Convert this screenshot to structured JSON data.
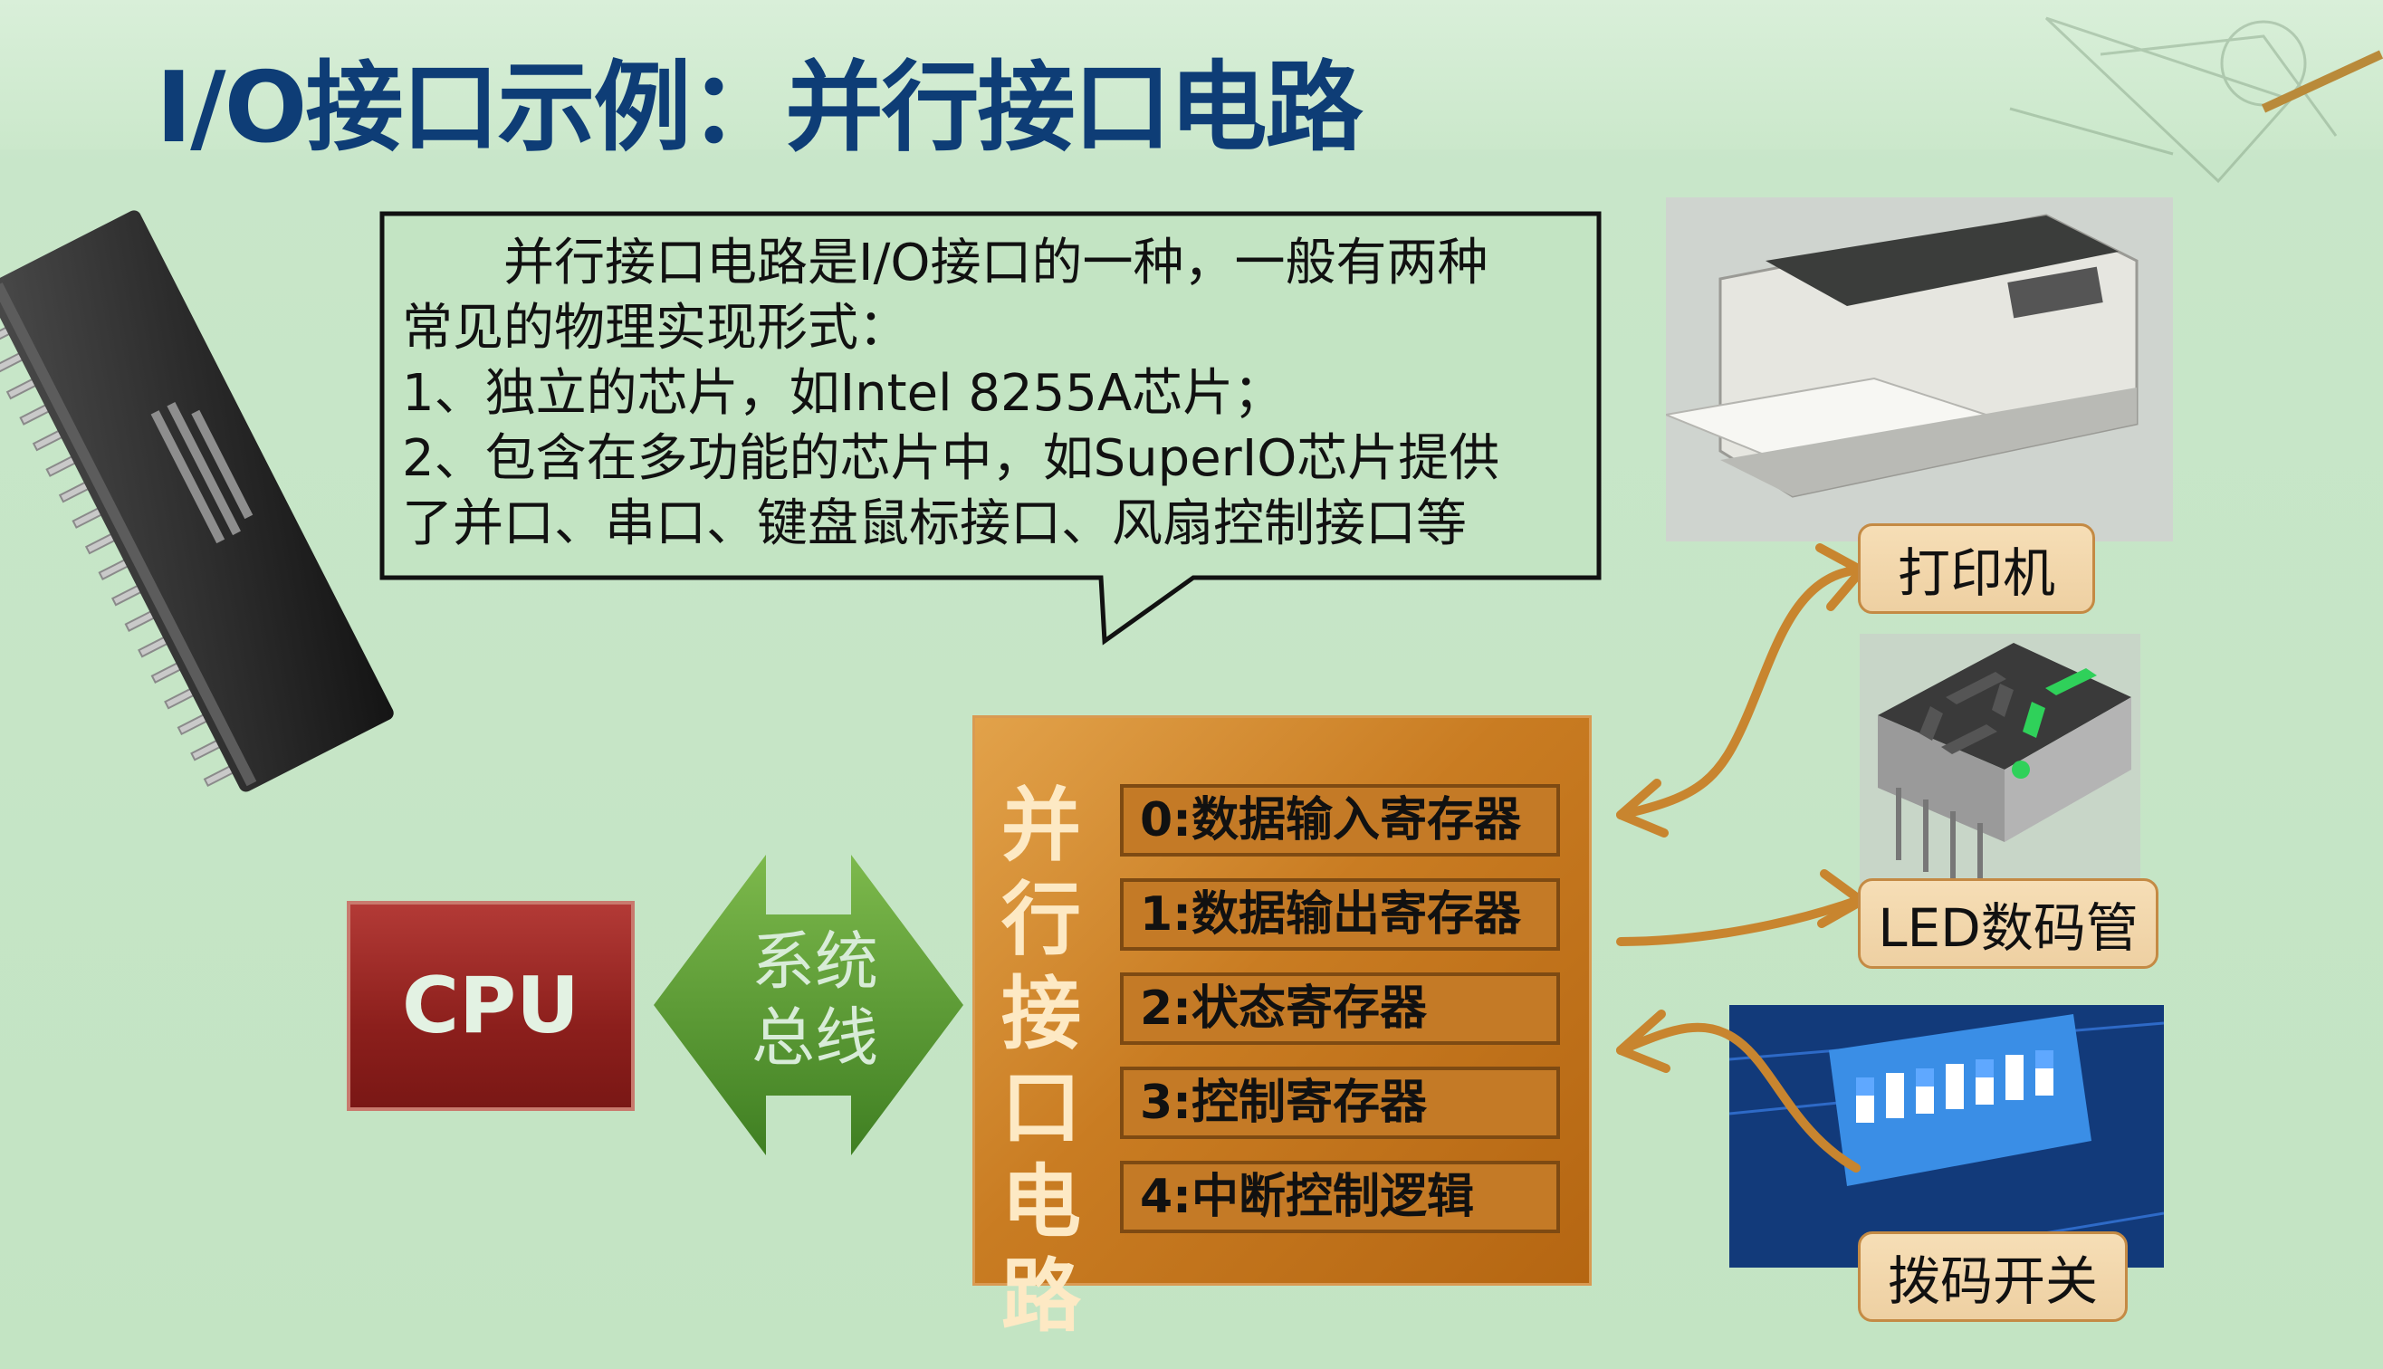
{
  "header": {
    "title": "I/O接口示例：并行接口电路"
  },
  "callout": {
    "lines": [
      "　　并行接口电路是I/O接口的一种，一般有两种",
      "常见的物理实现形式：",
      "1、独立的芯片，如Intel 8255A芯片；",
      "2、包含在多功能的芯片中，如SuperIO芯片提供",
      "了并口、串口、键盘鼠标接口、风扇控制接口等"
    ]
  },
  "cpu": {
    "label": "CPU"
  },
  "bus": {
    "line1": "系统",
    "line2": "总线"
  },
  "interface": {
    "title_chars": [
      "并",
      "行",
      "接",
      "口",
      "电",
      "路"
    ],
    "registers": [
      "0:数据输入寄存器",
      "1:数据输出寄存器",
      "2:状态寄存器",
      "3:控制寄存器",
      "4:中断控制逻辑"
    ]
  },
  "devices": {
    "printer": "打印机",
    "led": "LED数码管",
    "dip": "拨码开关"
  },
  "colors": {
    "title": "#0e3d76",
    "background": "#c3e4c3",
    "cpu": "#9e2a27",
    "bus_arrow": "#5e9b35",
    "interface": "#c97c22",
    "arrow": "#c8852f",
    "label_bg": "#f2d6aa"
  },
  "images": [
    "chip-photo",
    "printer-photo",
    "seven-segment-display-photo",
    "dip-switch-photo"
  ]
}
